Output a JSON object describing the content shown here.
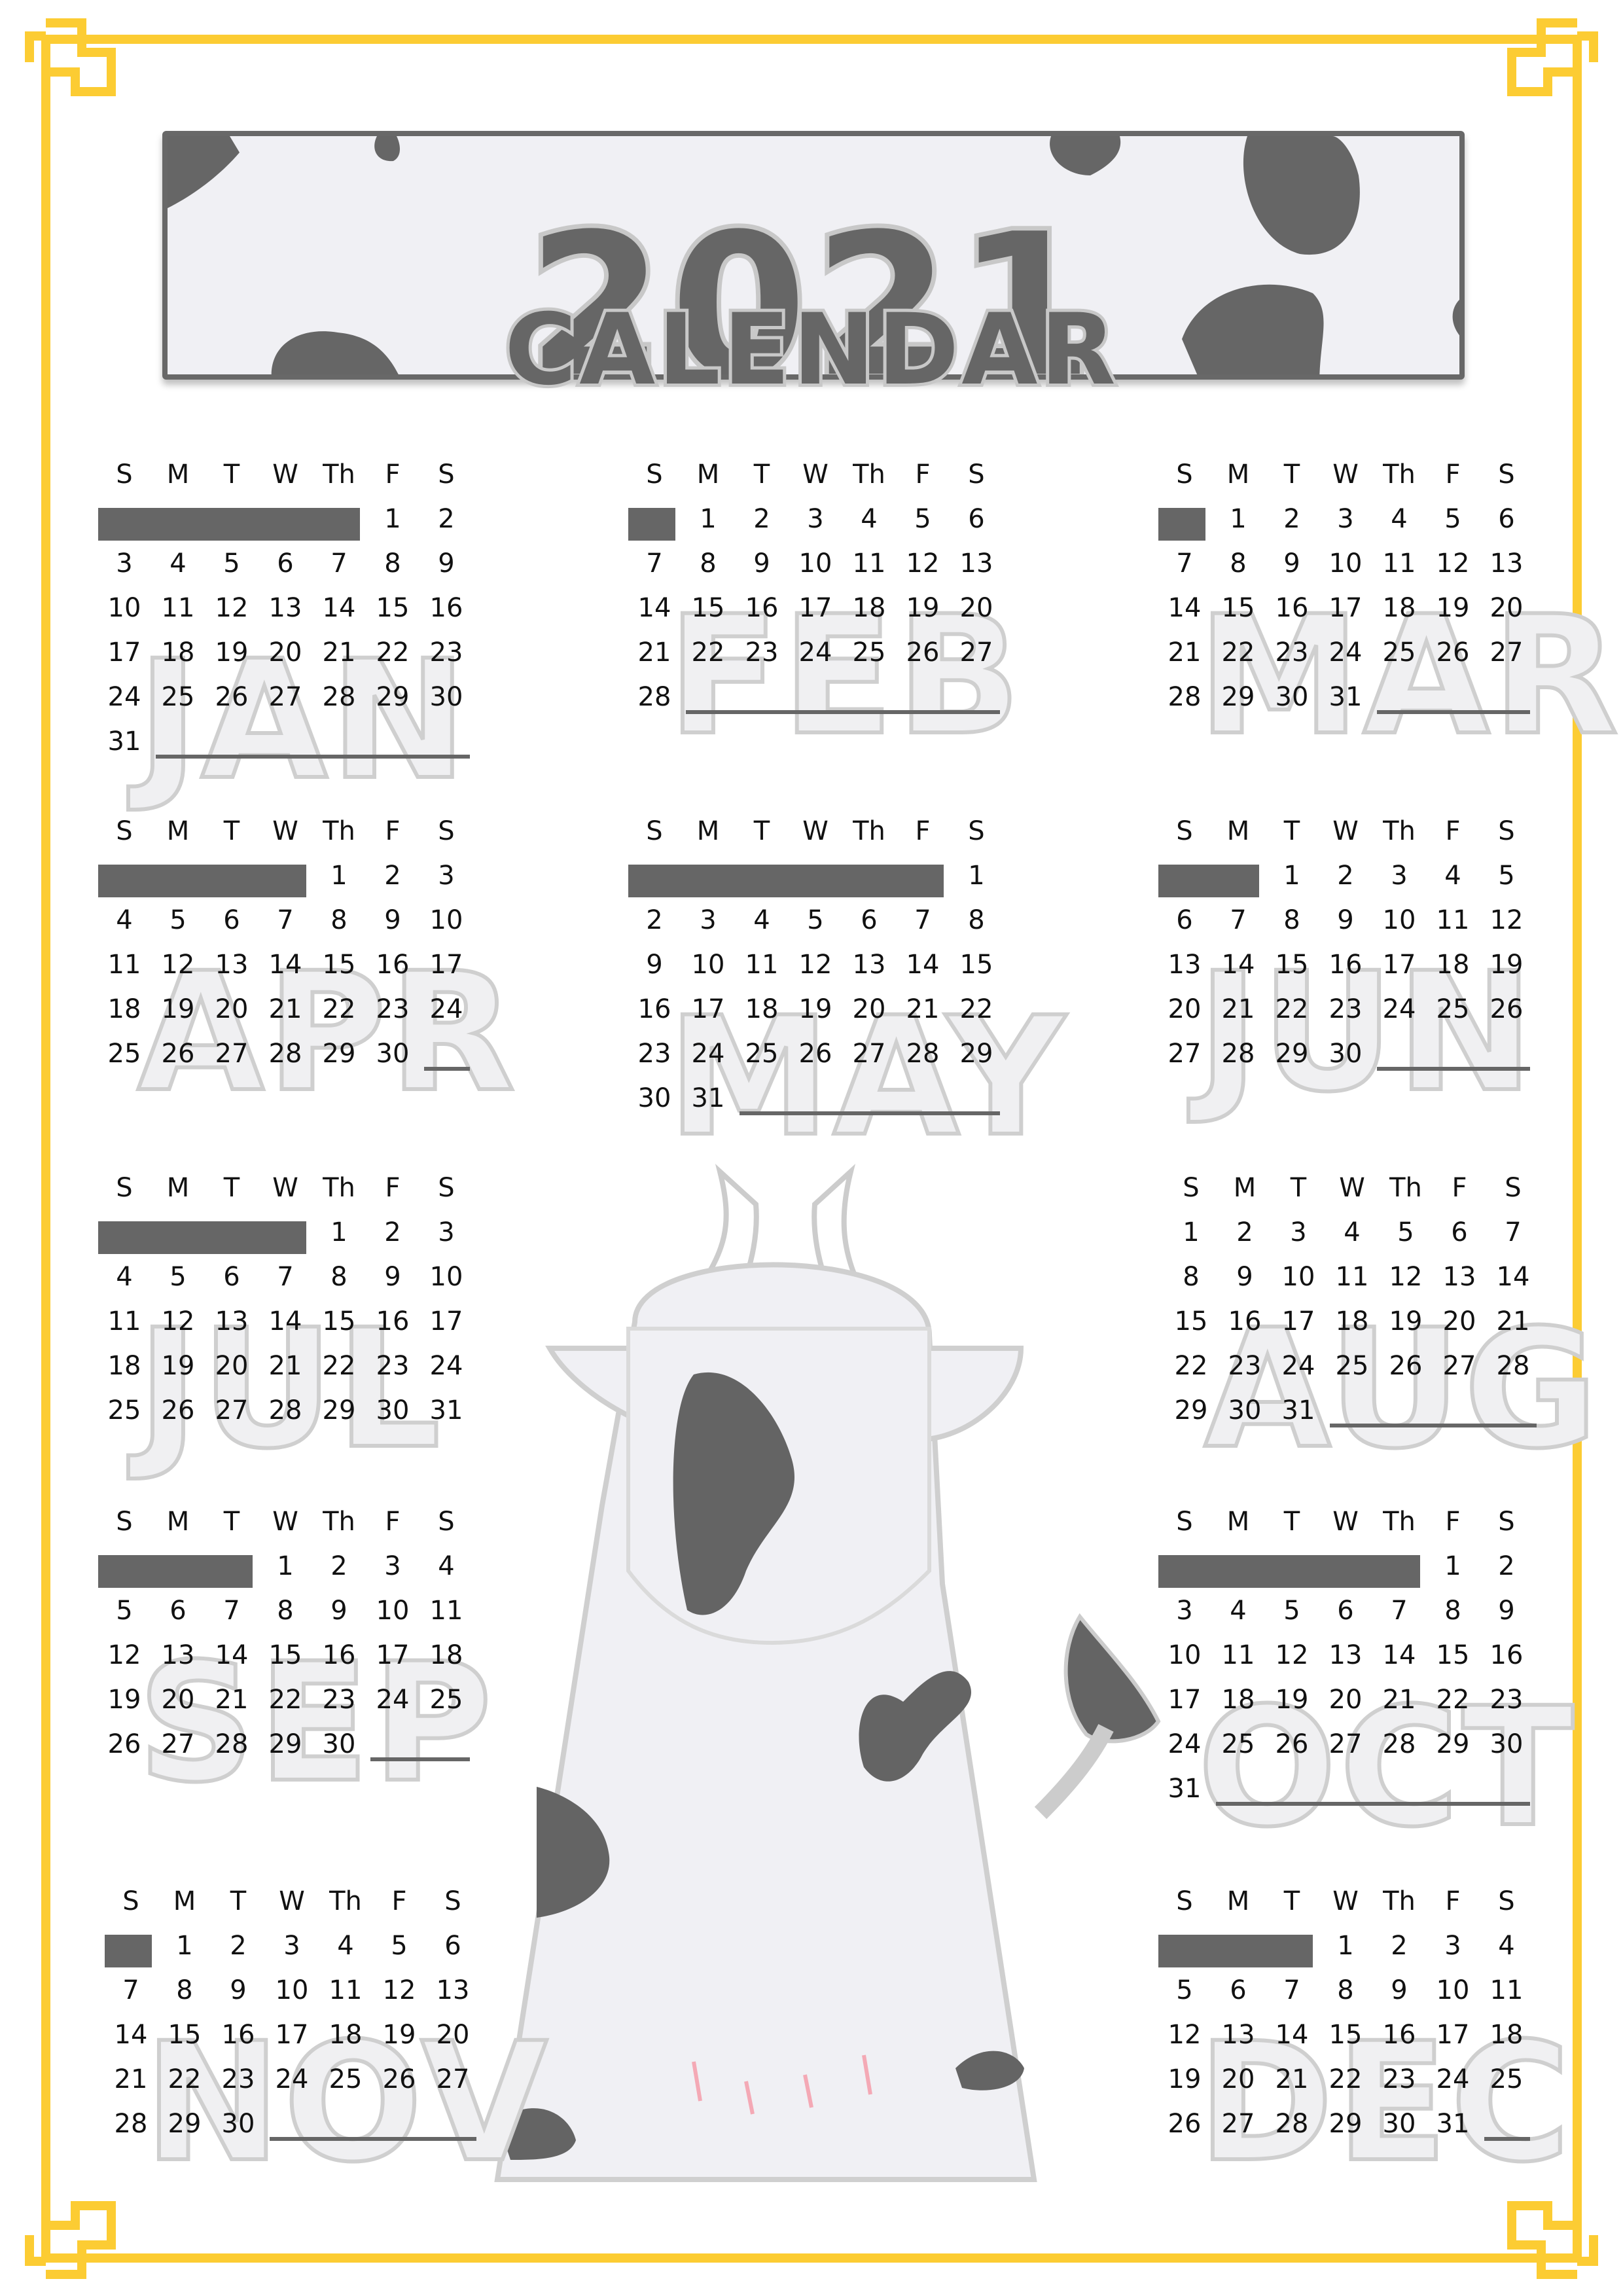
{
  "banner": {
    "year": "2021",
    "subtitle": "CALENDAR"
  },
  "weekdays": [
    "S",
    "M",
    "T",
    "W",
    "Th",
    "F",
    "S"
  ],
  "months": [
    {
      "name": "JAN",
      "start": 5,
      "days": 31
    },
    {
      "name": "FEB",
      "start": 1,
      "days": 28
    },
    {
      "name": "MAR",
      "start": 1,
      "days": 31
    },
    {
      "name": "APR",
      "start": 4,
      "days": 30
    },
    {
      "name": "MAY",
      "start": 6,
      "days": 31
    },
    {
      "name": "JUN",
      "start": 2,
      "days": 30
    },
    {
      "name": "JUL",
      "start": 4,
      "days": 31
    },
    {
      "name": "AUG",
      "start": 0,
      "days": 31
    },
    {
      "name": "SEP",
      "start": 3,
      "days": 30
    },
    {
      "name": "OCT",
      "start": 5,
      "days": 31
    },
    {
      "name": "NOV",
      "start": 1,
      "days": 30
    },
    {
      "name": "DEC",
      "start": 3,
      "days": 31
    }
  ],
  "colors": {
    "frame": "#fccc33",
    "accent": "#666666",
    "cow_body": "#f0f0f4",
    "cow_spot": "#646464"
  }
}
